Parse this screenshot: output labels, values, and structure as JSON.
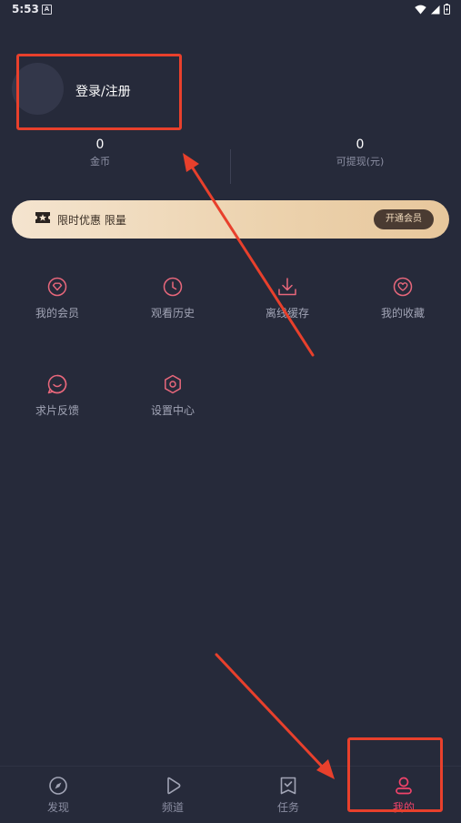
{
  "status_bar": {
    "time": "5:53",
    "notif_letter": "A"
  },
  "profile": {
    "login_label": "登录/注册"
  },
  "stats": [
    {
      "value": "0",
      "label": "金币"
    },
    {
      "value": "0",
      "label": "可提现(元)"
    }
  ],
  "vip_banner": {
    "text": "限时优惠 限量",
    "button_label": "开通会员"
  },
  "menu": [
    {
      "label": "我的会员",
      "icon": "diamond-icon"
    },
    {
      "label": "观看历史",
      "icon": "clock-icon"
    },
    {
      "label": "离线缓存",
      "icon": "download-icon"
    },
    {
      "label": "我的收藏",
      "icon": "heart-icon"
    },
    {
      "label": "求片反馈",
      "icon": "smile-chat-icon"
    },
    {
      "label": "设置中心",
      "icon": "settings-hexagon-icon"
    }
  ],
  "bottom_nav": [
    {
      "label": "发现",
      "icon": "compass-icon"
    },
    {
      "label": "频道",
      "icon": "play-icon"
    },
    {
      "label": "任务",
      "icon": "task-bookmark-icon"
    },
    {
      "label": "我的",
      "icon": "user-icon",
      "active": true
    }
  ],
  "colors": {
    "background": "#262a3a",
    "accent": "#f0436a",
    "menu_icon": "#e8677b",
    "annotation": "#e8402c",
    "vip_gold": "#ecd2ad"
  }
}
